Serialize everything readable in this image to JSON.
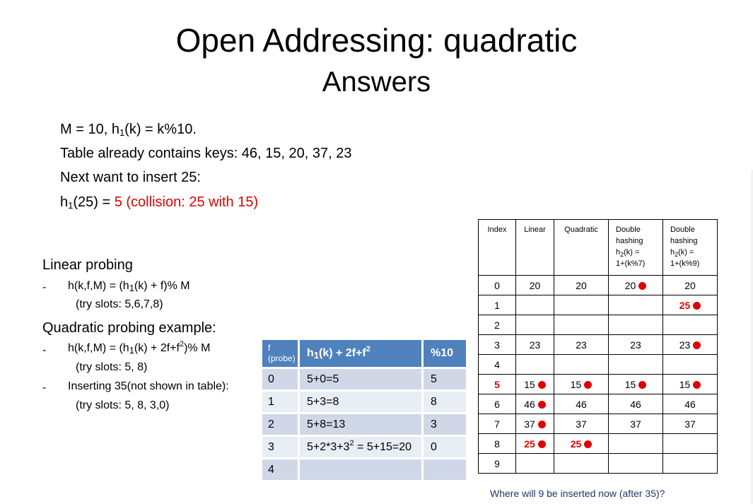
{
  "title": {
    "line1": "Open Addressing: quadratic",
    "line2": "Answers"
  },
  "intro": {
    "line1": {
      "a": "M = 10,   h",
      "sub": "1",
      "b": "(k) = k%10."
    },
    "line2": "Table already contains keys:  46, 15, 20, 37, 23",
    "line3": "Next want to insert 25:",
    "line4": {
      "a": "h",
      "sub": "1",
      "b": "(25)  = ",
      "red": "5  (collision: 25 with 15)"
    }
  },
  "linear": {
    "heading": "Linear probing",
    "dash": "-",
    "formula": {
      "a": "h(k,f,M) = (h",
      "sub": "1",
      "b": "(k) + f)% M"
    },
    "try": "(try slots: 5,6,7,8)"
  },
  "quadratic": {
    "heading": "Quadratic probing example:",
    "dash": "-",
    "formula": {
      "a": "h(k,f,M) = (h",
      "sub": "1",
      "b": "(k) + 2f+f",
      "sup": "2",
      "c": ")% M"
    },
    "try": "(try slots: 5, 8)",
    "insert_dash": "-",
    "insert": "Inserting 35(not shown in table):",
    "insert_try": "(try slots: 5, 8, 3,0)"
  },
  "probe_table": {
    "header": {
      "f": "f",
      "probe": "(probe)",
      "h_a": "h",
      "h_sub": "1",
      "h_b": "(k) + 2f+f",
      "h_sup": "2",
      "mod": "%10"
    },
    "rows": [
      {
        "f": "0",
        "expr": "5+0=5",
        "mod": "5"
      },
      {
        "f": "1",
        "expr": "5+3=8",
        "mod": "8"
      },
      {
        "f": "2",
        "expr": "5+8=13",
        "mod": "3"
      },
      {
        "f": "3",
        "expr_a": "5+2*3+3",
        "expr_sup": "2",
        "expr_b": " = 5+15=20",
        "mod": "0"
      },
      {
        "f": "4",
        "expr": "",
        "mod": ""
      }
    ]
  },
  "hash_table": {
    "headers": {
      "index": "Index",
      "linear": "Linear",
      "quadratic": "Quadratic",
      "dh1": {
        "l1": "Double",
        "l2": "hashing",
        "l3a": "h",
        "l3sub": "2",
        "l3b": "(k) =",
        "l4": "1+(k%7)"
      },
      "dh2": {
        "l1": "Double",
        "l2": "hashing",
        "l3a": "h",
        "l3sub": "2",
        "l3b": "(k) =",
        "l4": "1+(k%9)"
      }
    },
    "rows": [
      {
        "index": "0",
        "linear": "20",
        "quadratic": "20",
        "dh1": "20",
        "dh2": "20"
      },
      {
        "index": "1",
        "linear": "",
        "quadratic": "",
        "dh1": "",
        "dh2": "25"
      },
      {
        "index": "2",
        "linear": "",
        "quadratic": "",
        "dh1": "",
        "dh2": ""
      },
      {
        "index": "3",
        "linear": "23",
        "quadratic": "23",
        "dh1": "23",
        "dh2": "23"
      },
      {
        "index": "4",
        "linear": "",
        "quadratic": "",
        "dh1": "",
        "dh2": ""
      },
      {
        "index": "5",
        "linear": "15",
        "quadratic": "15",
        "dh1": "15",
        "dh2": "15"
      },
      {
        "index": "6",
        "linear": "46",
        "quadratic": "46",
        "dh1": "46",
        "dh2": "46"
      },
      {
        "index": "7",
        "linear": "37",
        "quadratic": "37",
        "dh1": "37",
        "dh2": "37"
      },
      {
        "index": "8",
        "linear": "25",
        "quadratic": "25",
        "dh1": "",
        "dh2": ""
      },
      {
        "index": "9",
        "linear": "",
        "quadratic": "",
        "dh1": "",
        "dh2": ""
      }
    ],
    "highlight_color": "#e00000"
  },
  "question": "Where will  9 be inserted now (after 35)?",
  "colors": {
    "header_blue": "#4f81bd",
    "row_dark": "#d0d8e8",
    "row_light": "#e9edf4",
    "accent_red": "#e00000"
  }
}
